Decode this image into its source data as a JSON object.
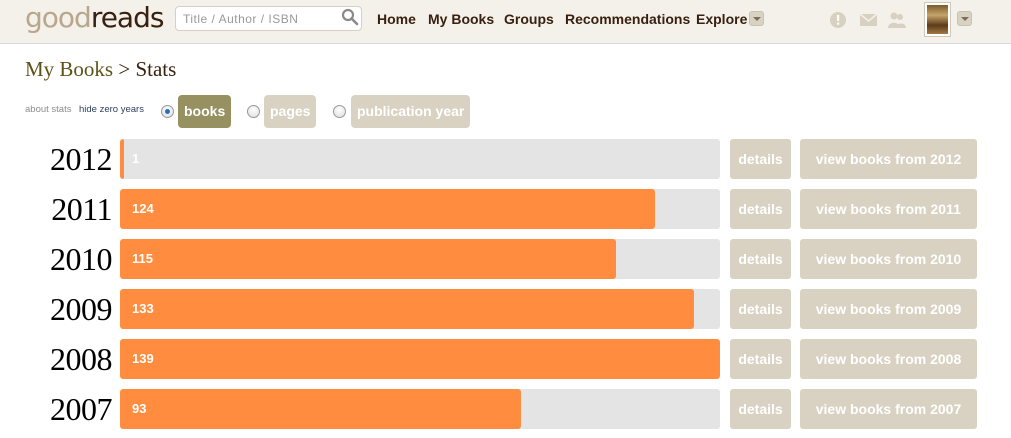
{
  "header": {
    "logo_prefix": "good",
    "logo_suffix": "reads",
    "search_placeholder": "Title / Author / ISBN",
    "nav": [
      "Home",
      "My Books",
      "Groups",
      "Recommendations",
      "Explore"
    ]
  },
  "breadcrumb": {
    "parent": "My Books",
    "separator": ">",
    "current": "Stats"
  },
  "controls": {
    "about_stats": "about stats",
    "hide_zero_years": "hide zero years",
    "options": [
      {
        "label": "books",
        "selected": true
      },
      {
        "label": "pages",
        "selected": false
      },
      {
        "label": "publication year",
        "selected": false
      }
    ]
  },
  "stats": {
    "max_value": 139,
    "rows": [
      {
        "year": "2012",
        "value": 1,
        "value_label": "1",
        "details": "details",
        "view": "view books from 2012"
      },
      {
        "year": "2011",
        "value": 124,
        "value_label": "124",
        "details": "details",
        "view": "view books from 2011"
      },
      {
        "year": "2010",
        "value": 115,
        "value_label": "115",
        "details": "details",
        "view": "view books from 2010"
      },
      {
        "year": "2009",
        "value": 133,
        "value_label": "133",
        "details": "details",
        "view": "view books from 2009"
      },
      {
        "year": "2008",
        "value": 139,
        "value_label": "139",
        "details": "details",
        "view": "view books from 2008"
      },
      {
        "year": "2007",
        "value": 93,
        "value_label": "93",
        "details": "details",
        "view": "view books from 2007"
      }
    ]
  },
  "colors": {
    "bar": "#ff8c3f",
    "track": "#e4e4e4",
    "button": "#d9d2c3",
    "active_toggle": "#979161",
    "link": "#5b5317"
  },
  "icons": [
    "search-icon",
    "alert-icon",
    "mail-icon",
    "friends-icon",
    "chevron-down-icon"
  ]
}
